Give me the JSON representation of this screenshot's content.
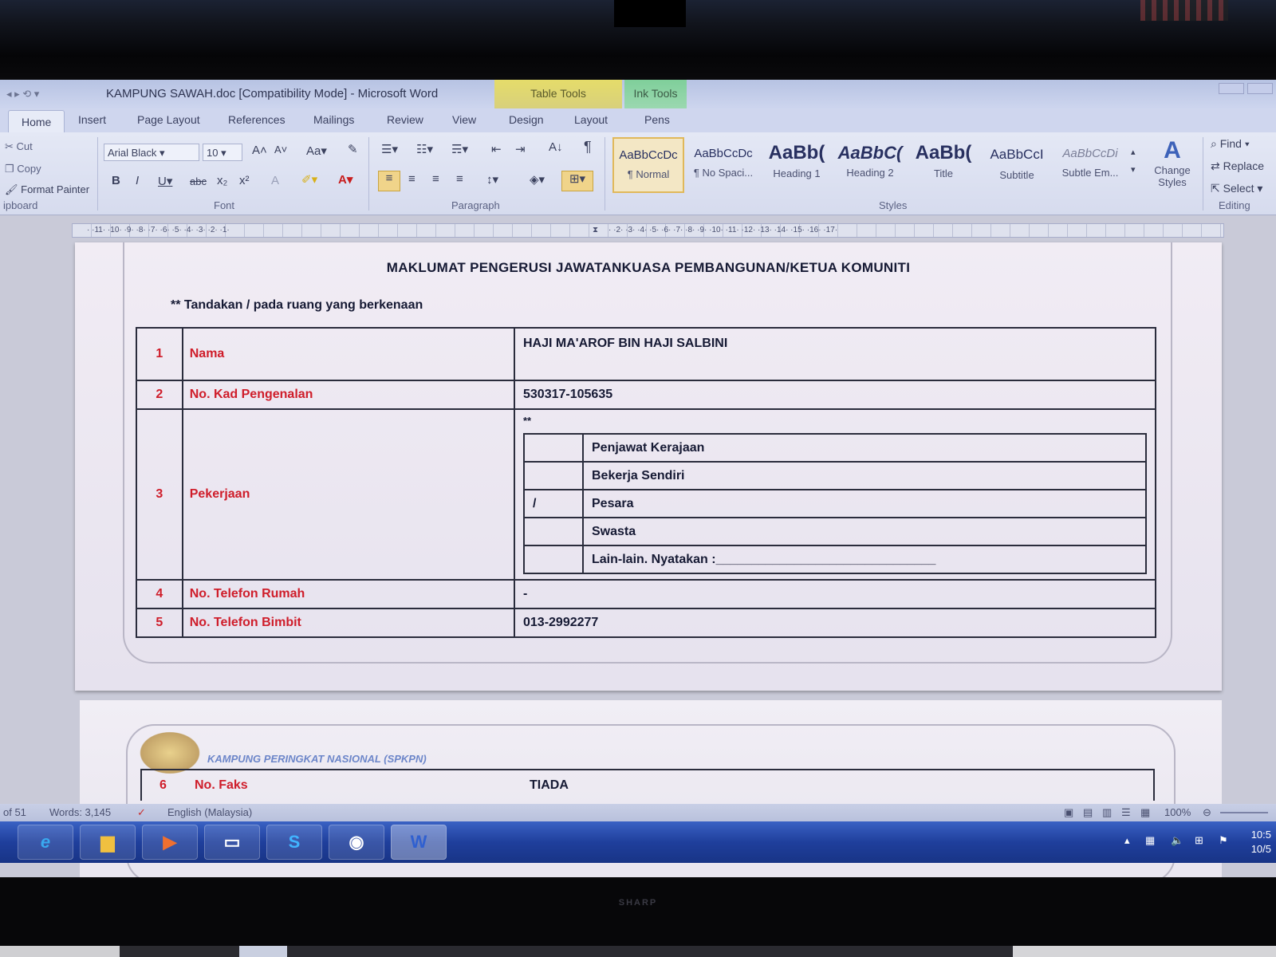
{
  "window": {
    "title": "KAMPUNG SAWAH.doc [Compatibility Mode] - Microsoft Word",
    "context_table": "Table Tools",
    "context_ink": "Ink Tools"
  },
  "tabs": [
    "Home",
    "Insert",
    "Page Layout",
    "References",
    "Mailings",
    "Review",
    "View",
    "Design",
    "Layout",
    "Pens"
  ],
  "ribbon": {
    "clipboard": {
      "cut": "Cut",
      "copy": "Copy",
      "format_painter": "Format Painter",
      "label": "ipboard"
    },
    "font": {
      "name": "Arial Black",
      "size": "10",
      "label": "Font"
    },
    "paragraph": {
      "label": "Paragraph"
    },
    "styles": {
      "label": "Styles",
      "items": [
        {
          "preview": "AaBbCcDc",
          "name": "¶ Normal"
        },
        {
          "preview": "AaBbCcDc",
          "name": "¶ No Spaci..."
        },
        {
          "preview": "AaBb(",
          "name": "Heading 1"
        },
        {
          "preview": "AaBbC(",
          "name": "Heading 2"
        },
        {
          "preview": "AaBb(",
          "name": "Title"
        },
        {
          "preview": "AaBbCcI",
          "name": "Subtitle"
        },
        {
          "preview": "AaBbCcDi",
          "name": "Subtle Em..."
        }
      ],
      "change_styles": "Change Styles"
    },
    "editing": {
      "find": "Find",
      "replace": "Replace",
      "select": "Select",
      "label": "Editing"
    }
  },
  "ruler": {
    "left_text": "· ·11· ·10· ·9· ·8· ·7· ·6· ·5· ·4· ·3· ·2· ·1·",
    "right_text": "· ·2· ·3· ·4· ·5· ·6· ·7· ·8· ·9· ·10· ·11· ·12· ·13· ·14· ·15· ·16· ·17·"
  },
  "document": {
    "title": "MAKLUMAT PENGERUSI JAWATANKUASA PEMBANGUNAN/KETUA KOMUNITI",
    "instruction": "** Tandakan / pada ruang yang berkenaan",
    "rows": [
      {
        "no": "1",
        "label": "Nama",
        "value": "HAJI MA'AROF BIN HAJI SALBINI"
      },
      {
        "no": "2",
        "label": "No. Kad Pengenalan",
        "value": "530317-105635"
      },
      {
        "no": "3",
        "label": "Pekerjaan",
        "value": "**"
      },
      {
        "no": "4",
        "label": "No. Telefon Rumah",
        "value": "-"
      },
      {
        "no": "5",
        "label": "No. Telefon Bimbit",
        "value": "013-2992277"
      }
    ],
    "occupations": [
      {
        "mark": "",
        "label": "Penjawat Kerajaan"
      },
      {
        "mark": "",
        "label": "Bekerja Sendiri"
      },
      {
        "mark": "/",
        "label": "Pesara"
      },
      {
        "mark": "",
        "label": "Swasta"
      },
      {
        "mark": "",
        "label": "Lain-lain. Nyatakan :_______________________________"
      }
    ],
    "page2": {
      "banner": "KAMPUNG PERINGKAT NASIONAL (SPKPN)",
      "row_no": "6",
      "row_label": "No. Faks",
      "row_value": "TIADA"
    }
  },
  "status": {
    "page": "of 51",
    "words": "Words: 3,145",
    "language": "English (Malaysia)",
    "zoom": "100%"
  },
  "taskbar": {
    "apps": [
      "internet-explorer",
      "file-explorer",
      "media-player",
      "remote-desktop",
      "skype",
      "chrome",
      "word"
    ],
    "clock_time": "10:5",
    "clock_date": "10/5"
  },
  "monitor": {
    "brand": "SHARP"
  }
}
